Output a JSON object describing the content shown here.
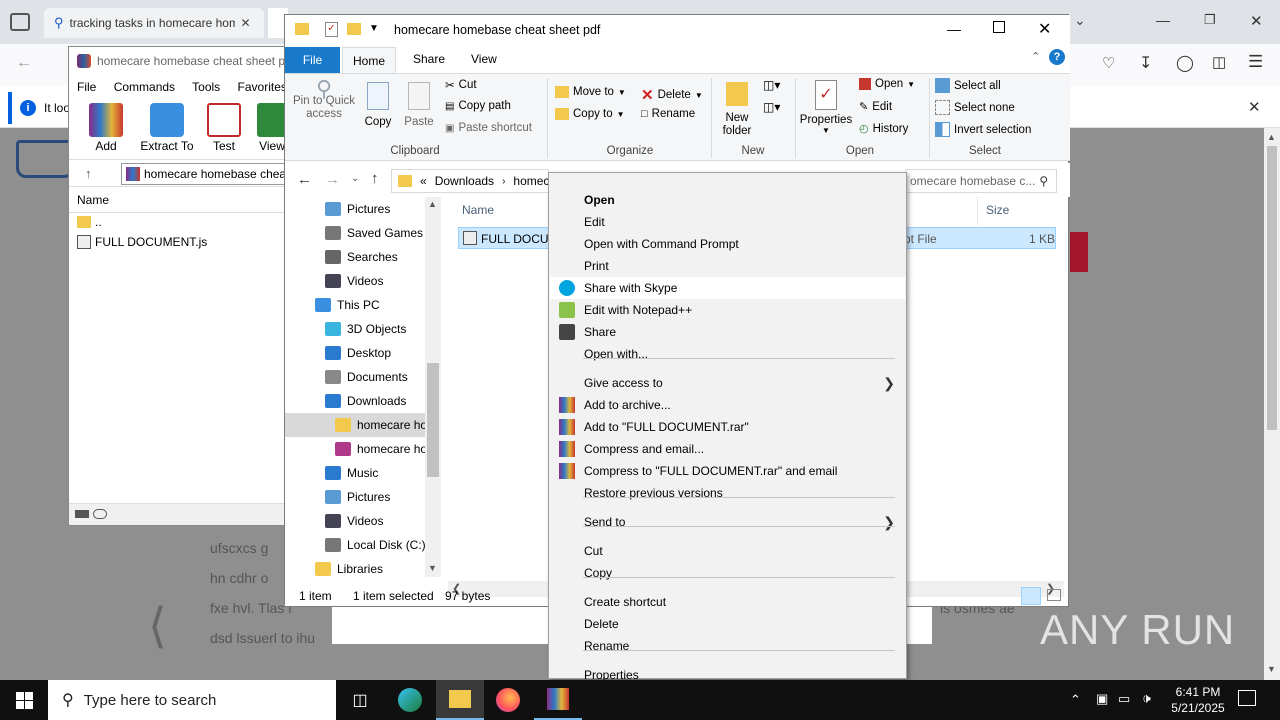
{
  "browser": {
    "tab1_title": "tracking tasks in homecare hom",
    "info_text": "It loo"
  },
  "page_bg_text": {
    "line1": "ufscxcs g",
    "line2": "hn cdhr o",
    "line3": "fxe hvl. Tlas l",
    "line4": "dsd lssuerl to ihu",
    "right": "ls osmes ae"
  },
  "winrar": {
    "title": "homecare homebase cheat sheet p",
    "menu": [
      "File",
      "Commands",
      "Tools",
      "Favorites"
    ],
    "toolbar": [
      "Add",
      "Extract To",
      "Test",
      "View"
    ],
    "path": "homecare homebase chea",
    "column_name": "Name",
    "files": [
      "..",
      "FULL DOCUMENT.js"
    ]
  },
  "explorer": {
    "title": "homecare homebase cheat sheet pdf",
    "tabs": [
      "File",
      "Home",
      "Share",
      "View"
    ],
    "ribbon": {
      "pin": "Pin to Quick access",
      "copy": "Copy",
      "paste": "Paste",
      "cut": "Cut",
      "copy_path": "Copy path",
      "paste_shortcut": "Paste shortcut",
      "clipboard": "Clipboard",
      "move_to": "Move to",
      "copy_to": "Copy to",
      "delete": "Delete",
      "rename": "Rename",
      "organize": "Organize",
      "new_folder": "New folder",
      "new": "New",
      "properties": "Properties",
      "open": "Open",
      "edit": "Edit",
      "history": "History",
      "open_group": "Open",
      "select_all": "Select all",
      "select_none": "Select none",
      "invert_selection": "Invert selection",
      "select": "Select"
    },
    "address": {
      "prefix": "«",
      "crumb1": "Downloads",
      "crumb2": "homec",
      "search": "omecare homebase c..."
    },
    "nav": [
      "Pictures",
      "Saved Games",
      "Searches",
      "Videos",
      "This PC",
      "3D Objects",
      "Desktop",
      "Documents",
      "Downloads",
      "homecare ho",
      "homecare ho",
      "Music",
      "Pictures",
      "Videos",
      "Local Disk (C:)",
      "Libraries"
    ],
    "columns": {
      "name": "Name",
      "size": "Size"
    },
    "file": {
      "name": "FULL DOCUM",
      "type": "pt File",
      "size": "1 KB"
    },
    "status": {
      "count": "1 item",
      "selected": "1 item selected",
      "bytes": "97 bytes"
    }
  },
  "context_menu": [
    "Open",
    "Edit",
    "Open with Command Prompt",
    "Print",
    "Share with Skype",
    "Edit with Notepad++",
    "Share",
    "Open with...",
    "Give access to",
    "Add to archive...",
    "Add to \"FULL DOCUMENT.rar\"",
    "Compress and email...",
    "Compress to \"FULL DOCUMENT.rar\" and email",
    "Restore previous versions",
    "Send to",
    "Cut",
    "Copy",
    "Create shortcut",
    "Delete",
    "Rename",
    "Properties"
  ],
  "taskbar": {
    "search_placeholder": "Type here to search",
    "time": "6:41 PM",
    "date": "5/21/2025"
  },
  "watermark": "ANY RUN"
}
